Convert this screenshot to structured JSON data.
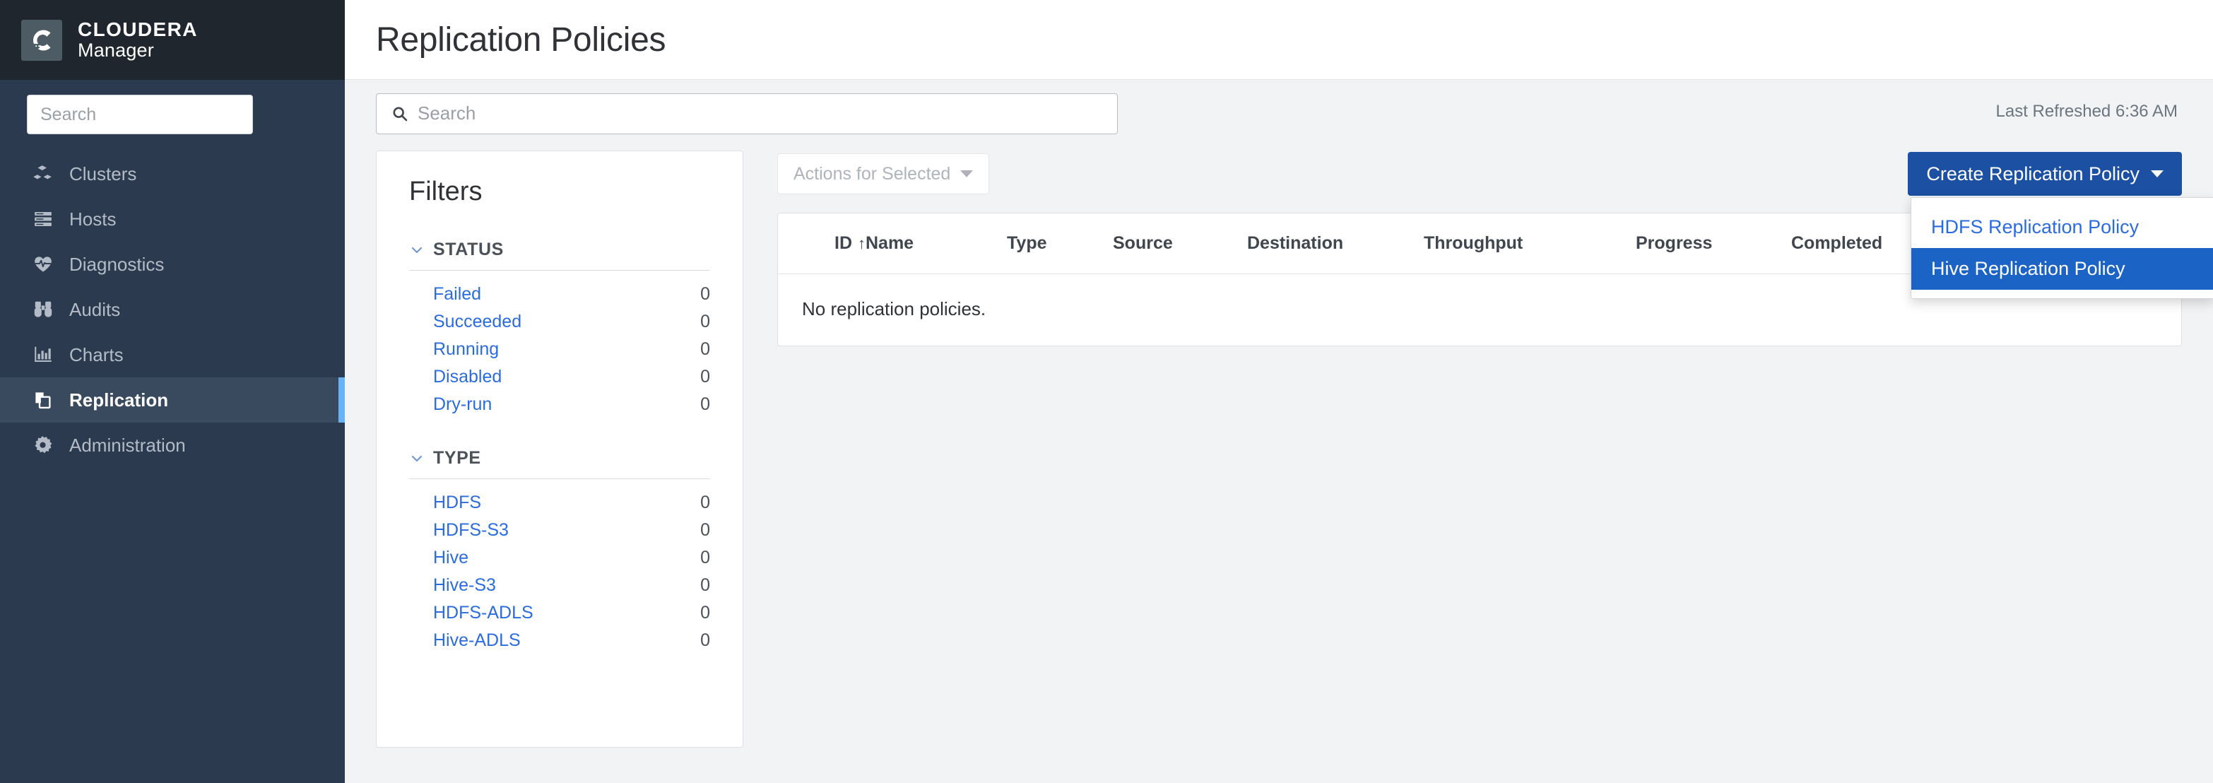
{
  "brand": {
    "logo_icon": "cloudera-c-logo",
    "line1": "CLOUDERA",
    "line2": "Manager"
  },
  "sidebar": {
    "search": {
      "placeholder": "Search",
      "value": ""
    },
    "items": [
      {
        "label": "Clusters",
        "icon": "clusters-icon",
        "active": false
      },
      {
        "label": "Hosts",
        "icon": "hosts-icon",
        "active": false
      },
      {
        "label": "Diagnostics",
        "icon": "diagnostics-icon",
        "active": false
      },
      {
        "label": "Audits",
        "icon": "audits-icon",
        "active": false
      },
      {
        "label": "Charts",
        "icon": "charts-icon",
        "active": false
      },
      {
        "label": "Replication",
        "icon": "replication-icon",
        "active": true
      },
      {
        "label": "Administration",
        "icon": "administration-icon",
        "active": false
      }
    ]
  },
  "header": {
    "title": "Replication Policies"
  },
  "toolbar": {
    "search": {
      "placeholder": "Search",
      "value": "",
      "icon": "search-icon"
    },
    "last_refreshed": "Last Refreshed 6:36 AM"
  },
  "filters": {
    "title": "Filters",
    "groups": [
      {
        "label": "STATUS",
        "expanded": true,
        "chevron_icon": "chevron-down-icon",
        "rows": [
          {
            "label": "Failed",
            "count": "0"
          },
          {
            "label": "Succeeded",
            "count": "0"
          },
          {
            "label": "Running",
            "count": "0"
          },
          {
            "label": "Disabled",
            "count": "0"
          },
          {
            "label": "Dry-run",
            "count": "0"
          }
        ]
      },
      {
        "label": "TYPE",
        "expanded": true,
        "chevron_icon": "chevron-down-icon",
        "rows": [
          {
            "label": "HDFS",
            "count": "0"
          },
          {
            "label": "HDFS-S3",
            "count": "0"
          },
          {
            "label": "Hive",
            "count": "0"
          },
          {
            "label": "Hive-S3",
            "count": "0"
          },
          {
            "label": "HDFS-ADLS",
            "count": "0"
          },
          {
            "label": "Hive-ADLS",
            "count": "0"
          }
        ]
      }
    ]
  },
  "actions": {
    "actions_for_selected_label": "Actions for Selected",
    "actions_for_selected_enabled": false,
    "create_policy_label": "Create Replication Policy",
    "dropdown_open": true,
    "dropdown_items": [
      {
        "label": "HDFS Replication Policy",
        "highlighted": false
      },
      {
        "label": "Hive Replication Policy",
        "highlighted": true
      }
    ]
  },
  "table": {
    "columns": [
      {
        "key": "id",
        "label": "ID",
        "sorted": true,
        "sort_dir": "asc",
        "sort_glyph": "↑"
      },
      {
        "key": "name",
        "label": "Name"
      },
      {
        "key": "type",
        "label": "Type"
      },
      {
        "key": "source",
        "label": "Source"
      },
      {
        "key": "destination",
        "label": "Destination"
      },
      {
        "key": "throughput",
        "label": "Throughput"
      },
      {
        "key": "progress",
        "label": "Progress"
      },
      {
        "key": "completed",
        "label": "Completed"
      }
    ],
    "rows": [],
    "empty_message": "No replication policies."
  },
  "colors": {
    "sidebar_bg": "#2b3a4e",
    "sidebar_brand_bg": "#1f262e",
    "sidebar_active_bg": "#3a4a5e",
    "sidebar_accent": "#68b3f5",
    "primary_button": "#1b50a3",
    "menu_highlight": "#1b63c4",
    "link": "#2a6ce0",
    "page_bg": "#f2f3f5"
  }
}
